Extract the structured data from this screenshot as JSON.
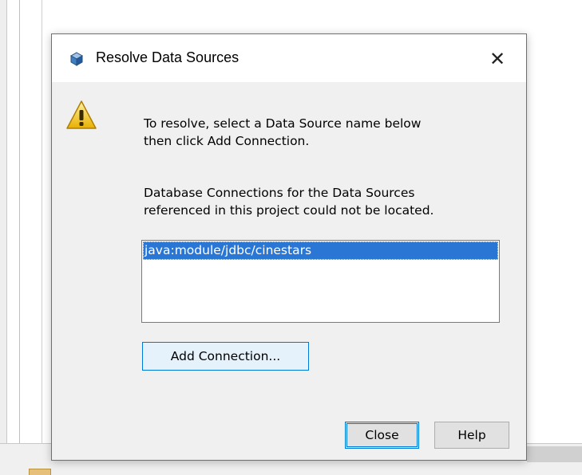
{
  "dialog": {
    "title": "Resolve Data Sources",
    "close_glyph": "✕",
    "icons": {
      "title": "cube-icon",
      "message": "warning-icon"
    },
    "message1": [
      "To resolve, select a Data Source name below",
      "then click Add Connection."
    ],
    "message2": [
      "Database Connections for the Data Sources",
      "referenced in this project could not be located."
    ],
    "data_sources": [
      "java:module/jdbc/cinestars"
    ],
    "selected_index": 0,
    "add_connection_label": "Add Connection...",
    "close_label": "Close",
    "help_label": "Help"
  },
  "colors": {
    "selection": "#2a76d4",
    "focus_border": "#0078d7",
    "dialog_bg": "#f0f0f0"
  }
}
